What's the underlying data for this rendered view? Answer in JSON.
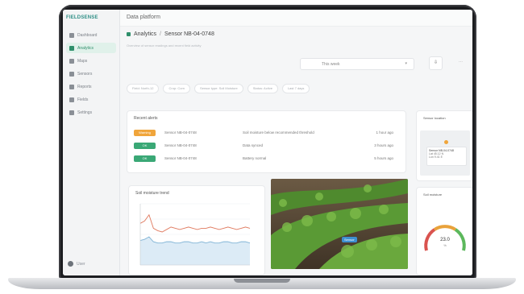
{
  "app": {
    "logo": "FIELDSENSE",
    "title": "Data platform"
  },
  "sidebar": {
    "items": [
      {
        "label": "Dashboard",
        "active": false
      },
      {
        "label": "Analytics",
        "active": true
      },
      {
        "label": "Maps",
        "active": false
      },
      {
        "label": "Sensors",
        "active": false
      },
      {
        "label": "Reports",
        "active": false
      },
      {
        "label": "Fields",
        "active": false
      },
      {
        "label": "Settings",
        "active": false
      }
    ],
    "user": "User"
  },
  "breadcrumb": {
    "root": "Analytics",
    "separator": "/",
    "current": "Sensor NB-04-0748"
  },
  "subtitle": "Overview of sensor readings and recent field activity",
  "filters": {
    "period": "This week",
    "chips": [
      "Field: North-12",
      "Crop: Corn",
      "Sensor type: Soil Moisture",
      "Status: Active",
      "Last 7 days"
    ]
  },
  "alerts": {
    "title": "Recent alerts",
    "rows": [
      {
        "badge": "Warning",
        "badge_color": "#f0a53b",
        "sensor": "Sensor NB-04-0748",
        "message": "Soil moisture below recommended threshold",
        "time": "1 hour ago"
      },
      {
        "badge": "OK",
        "badge_color": "#3aa876",
        "sensor": "Sensor NB-04-0748",
        "message": "Data synced",
        "time": "3 hours ago"
      },
      {
        "badge": "OK",
        "badge_color": "#3aa876",
        "sensor": "Sensor NB-04-0748",
        "message": "Battery normal",
        "time": "5 hours ago"
      }
    ]
  },
  "map_card": {
    "title": "Sensor location",
    "tooltip_title": "Sensor NB-04-0748",
    "tooltip_lines": [
      "Lat 45.12 N",
      "Lon 9.41 E"
    ]
  },
  "chart_card": {
    "title": "Soil moisture trend"
  },
  "chart_data": {
    "type": "line",
    "x": [
      1,
      2,
      3,
      4,
      5,
      6,
      7,
      8,
      9,
      10,
      11,
      12,
      13,
      14,
      15,
      16,
      17,
      18,
      19,
      20,
      21,
      22,
      23,
      24,
      25,
      26
    ],
    "series": [
      {
        "color": "#e07a5f",
        "values": [
          34,
          36,
          41,
          30,
          28,
          27,
          29,
          31,
          30,
          29,
          30,
          31,
          30,
          29,
          30,
          30,
          31,
          30,
          29,
          30,
          31,
          30,
          29,
          30,
          31,
          30
        ]
      },
      {
        "color": "#7fb3d5",
        "values": [
          20,
          21,
          23,
          19,
          18,
          18,
          19,
          19,
          18,
          18,
          19,
          19,
          18,
          18,
          19,
          18,
          19,
          18,
          18,
          19,
          19,
          18,
          18,
          19,
          19,
          18
        ]
      }
    ],
    "ylim": [
      0,
      50
    ],
    "grid": true
  },
  "photo": {
    "tag": "Sensor"
  },
  "gauge_card": {
    "title": "Soil moisture",
    "value_text": "23.0",
    "unit": "%",
    "value": 23.0,
    "max": 50
  }
}
